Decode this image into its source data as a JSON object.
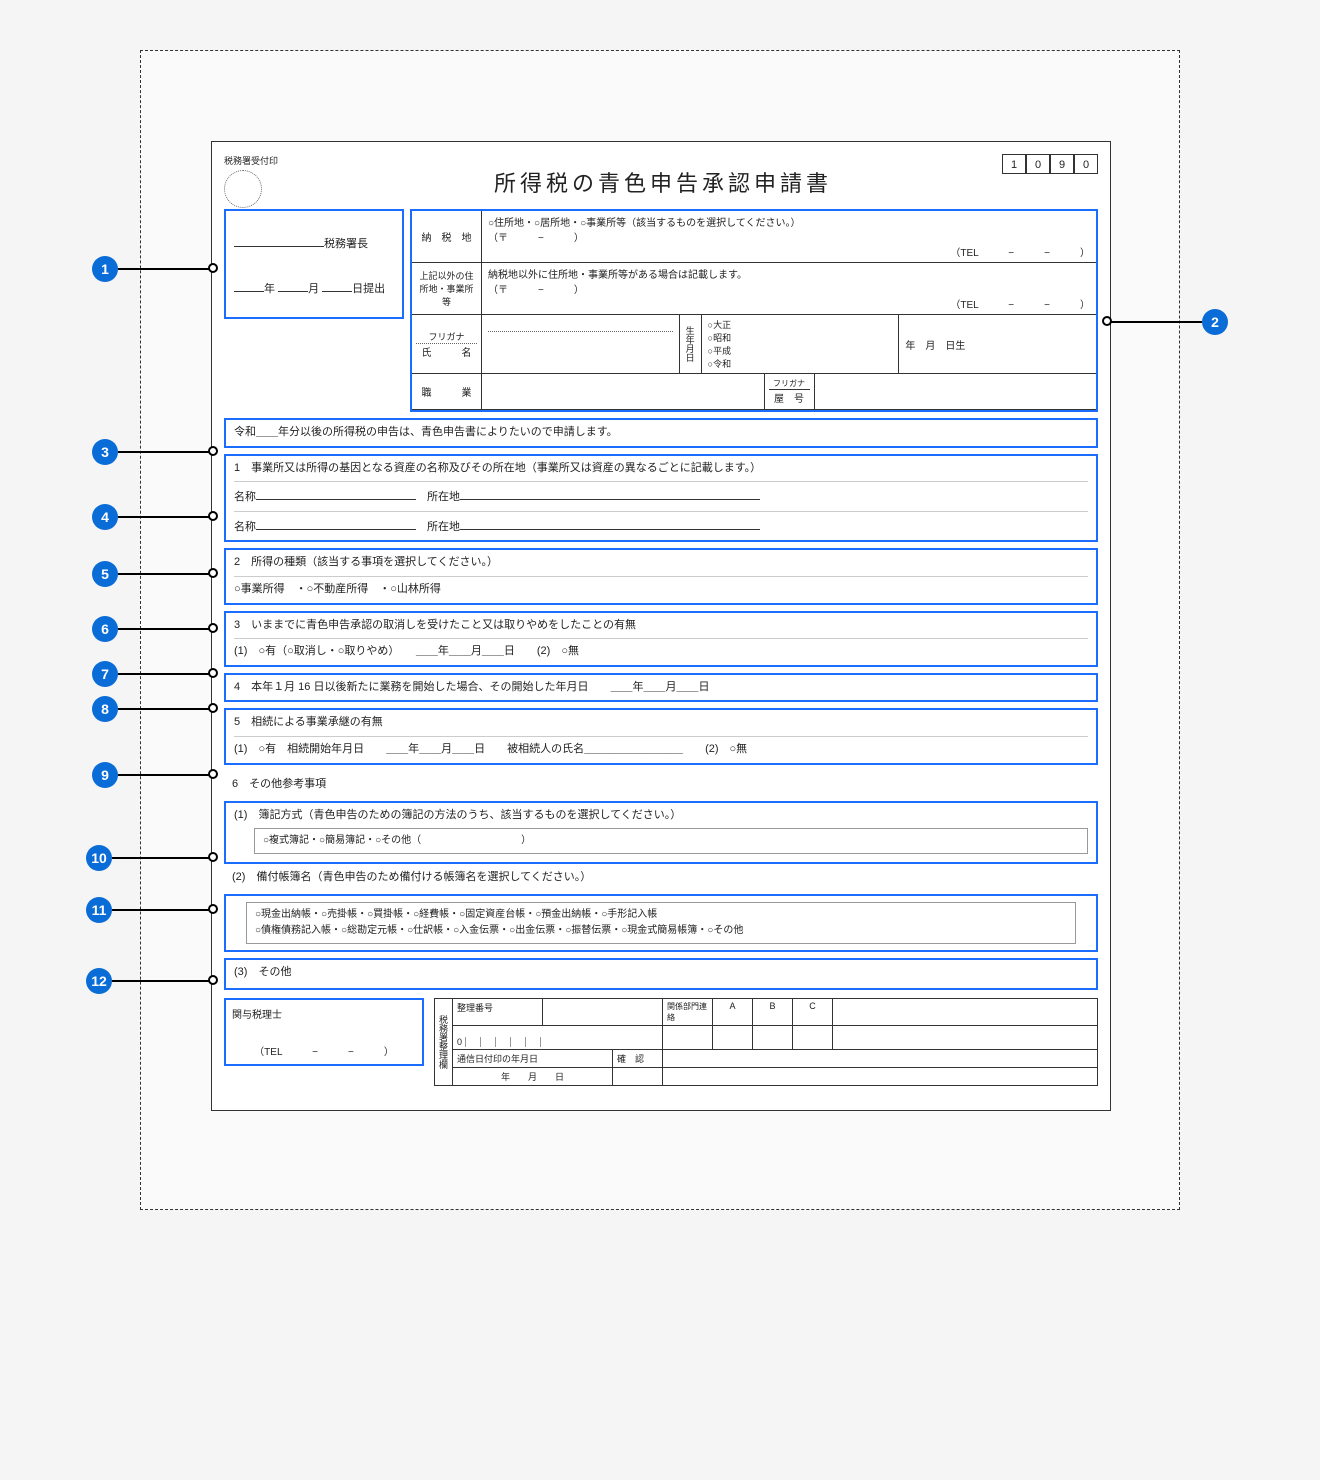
{
  "header": {
    "stamp_label": "税務署受付印",
    "title": "所得税の青色申告承認申請書",
    "code": [
      "1",
      "0",
      "9",
      "0"
    ]
  },
  "office": {
    "suffix": "税務署長",
    "date_y": "年",
    "date_m": "月",
    "date_d": "日提出"
  },
  "applicant": {
    "tax_place_label": "納　税　地",
    "tax_place_text": "○住所地・○居所地・○事業所等（該当するものを選択してください。）",
    "postal": "（〒　　　−　　　）",
    "tel": "（TEL　　　−　　　−　　　）",
    "other_addr_label": "上記以外の住所地・事業所等",
    "other_addr_text": "納税地以外に住所地・事業所等がある場合は記載します。",
    "furigana_label": "フリガナ",
    "name_label": "氏　　　名",
    "dob_label": "生年月日",
    "era_options": "○大正\n○昭和\n○平成\n○令和",
    "dob_suffix": "年　月　日生",
    "occupation_label": "職　　　業",
    "trade_furigana": "フリガナ",
    "trade_label": "屋　号"
  },
  "s3": "令和＿＿年分以後の所得税の申告は、青色申告書によりたいので申請します。",
  "s4": {
    "title": "1　事業所又は所得の基因となる資産の名称及びその所在地（事業所又は資産の異なるごとに記載します。）",
    "name_label": "名称",
    "loc_label": "所在地"
  },
  "s5": {
    "title": "2　所得の種類（該当する事項を選択してください。）",
    "options": "○事業所得　・○不動産所得　・○山林所得"
  },
  "s6": {
    "title": "3　いままでに青色申告承認の取消しを受けたこと又は取りやめをしたことの有無",
    "line": "(1)　○有（○取消し・○取りやめ）　　＿＿年＿＿月＿＿日　　(2)　○無"
  },
  "s7": "4　本年１月 16 日以後新たに業務を開始した場合、その開始した年月日　　＿＿年＿＿月＿＿日",
  "s8": {
    "title": "5　相続による事業承継の有無",
    "line": "(1)　○有　相続開始年月日　　＿＿年＿＿月＿＿日　　被相続人の氏名＿＿＿＿＿＿＿＿＿　　(2)　○無"
  },
  "s6_head": "6　その他参考事項",
  "s9": {
    "title": "(1)　簿記方式（青色申告のための簿記の方法のうち、該当するものを選択してください。）",
    "options": "○複式簿記・○簡易簿記・○その他（　　　　　　　　　　）"
  },
  "s10": {
    "title": "(2)　備付帳簿名（青色申告のため備付ける帳簿名を選択してください。）",
    "options": "○現金出納帳・○売掛帳・○買掛帳・○経費帳・○固定資産台帳・○預金出納帳・○手形記入帳\n○債権債務記入帳・○総勘定元帳・○仕訳帳・○入金伝票・○出金伝票・○振替伝票・○現金式簡易帳簿・○その他"
  },
  "s11": "(3)　その他",
  "s12": {
    "label": "関与税理士",
    "tel": "（TEL　　　−　　　−　　　）"
  },
  "admin": {
    "side": "税務署整理欄",
    "h1": "整理番号",
    "h2": "関係部門連絡",
    "cols": [
      "A",
      "B",
      "C"
    ],
    "r2": "通信日付印の年月日",
    "r2b": "確　認",
    "r3": "年　　月　　日"
  },
  "callouts": [
    "1",
    "2",
    "3",
    "4",
    "5",
    "6",
    "7",
    "8",
    "9",
    "10",
    "11",
    "12"
  ]
}
